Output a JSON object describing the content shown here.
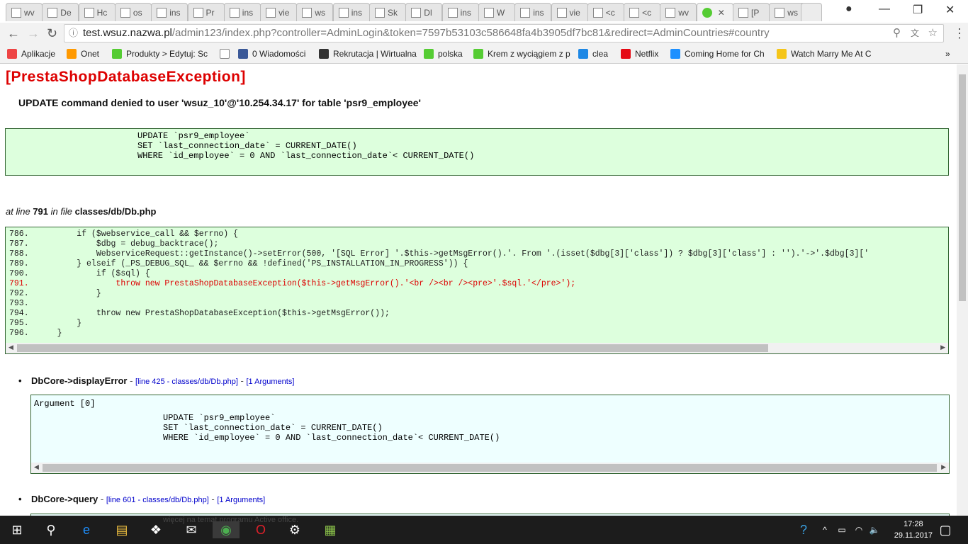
{
  "browser": {
    "tabs": [
      "wv",
      "De",
      "Hc",
      "os",
      "ins",
      "Pr",
      "ins",
      "vie",
      "ws",
      "ins",
      "Sk",
      "Dl",
      "ins",
      "W",
      "ins",
      "vie",
      "<c",
      "<c",
      "wv",
      "",
      "[P",
      "ws"
    ],
    "active_tab_index": 19,
    "url_host": "test.wsuz.nazwa.pl",
    "url_path": "/admin123/index.php?controller=AdminLogin&token=7597b53103c586648fa4b3905df7bc81&redirect=AdminCountries#country",
    "bookmarks": [
      "Aplikacje",
      "Onet",
      "Produkty > Edytuj: Sc",
      "",
      "0 Wiadomości",
      "Rekrutacja | Wirtualna",
      "polska",
      "Krem z wyciągiem z p",
      "clea",
      "Netflix",
      "Coming Home for Ch",
      "Watch Marry Me At C"
    ],
    "more": "»"
  },
  "page": {
    "title": "[PrestaShopDatabaseException]",
    "message": "UPDATE command denied to user 'wsuz_10'@'10.254.34.17' for table 'psr9_employee'",
    "sql": "UPDATE `psr9_employee`\nSET `last_connection_date` = CURRENT_DATE()\nWHERE `id_employee` = 0 AND `last_connection_date`< CURRENT_DATE()",
    "at_line_prefix": "at line ",
    "line": "791",
    "in_file": " in file ",
    "file": "classes/db/Db.php",
    "code_lines": [
      {
        "n": "786.",
        "t": "        if ($webservice_call && $errno) {"
      },
      {
        "n": "787.",
        "t": "            $dbg = debug_backtrace();"
      },
      {
        "n": "788.",
        "t": "            WebserviceRequest::getInstance()->setError(500, '[SQL Error] '.$this->getMsgError().'. From '.(isset($dbg[3]['class']) ? $dbg[3]['class'] : '').'->'.$dbg[3]['"
      },
      {
        "n": "789.",
        "t": "        } elseif (_PS_DEBUG_SQL_ && $errno && !defined('PS_INSTALLATION_IN_PROGRESS')) {"
      },
      {
        "n": "790.",
        "t": "            if ($sql) {"
      },
      {
        "n": "791.",
        "t": "                throw new PrestaShopDatabaseException($this->getMsgError().'<br /><br /><pre>'.$sql.'</pre>');",
        "hl": true
      },
      {
        "n": "792.",
        "t": "            }"
      },
      {
        "n": "793.",
        "t": ""
      },
      {
        "n": "794.",
        "t": "            throw new PrestaShopDatabaseException($this->getMsgError());"
      },
      {
        "n": "795.",
        "t": "        }"
      },
      {
        "n": "796.",
        "t": "    }"
      }
    ],
    "trace": [
      {
        "func": "DbCore->displayError",
        "dash": " - ",
        "loc": "[line 425 - classes/db/Db.php]",
        "args": "[1 Arguments]",
        "arg_title": "Argument [0]"
      },
      {
        "func": "DbCore->query",
        "dash": " - ",
        "loc": "[line 601 - classes/db/Db.php]",
        "args": "[1 Arguments]"
      }
    ]
  },
  "taskbar": {
    "ghost_text": "więcej na temat programu Active office.",
    "time": "17:28",
    "date": "29.11.2017"
  }
}
